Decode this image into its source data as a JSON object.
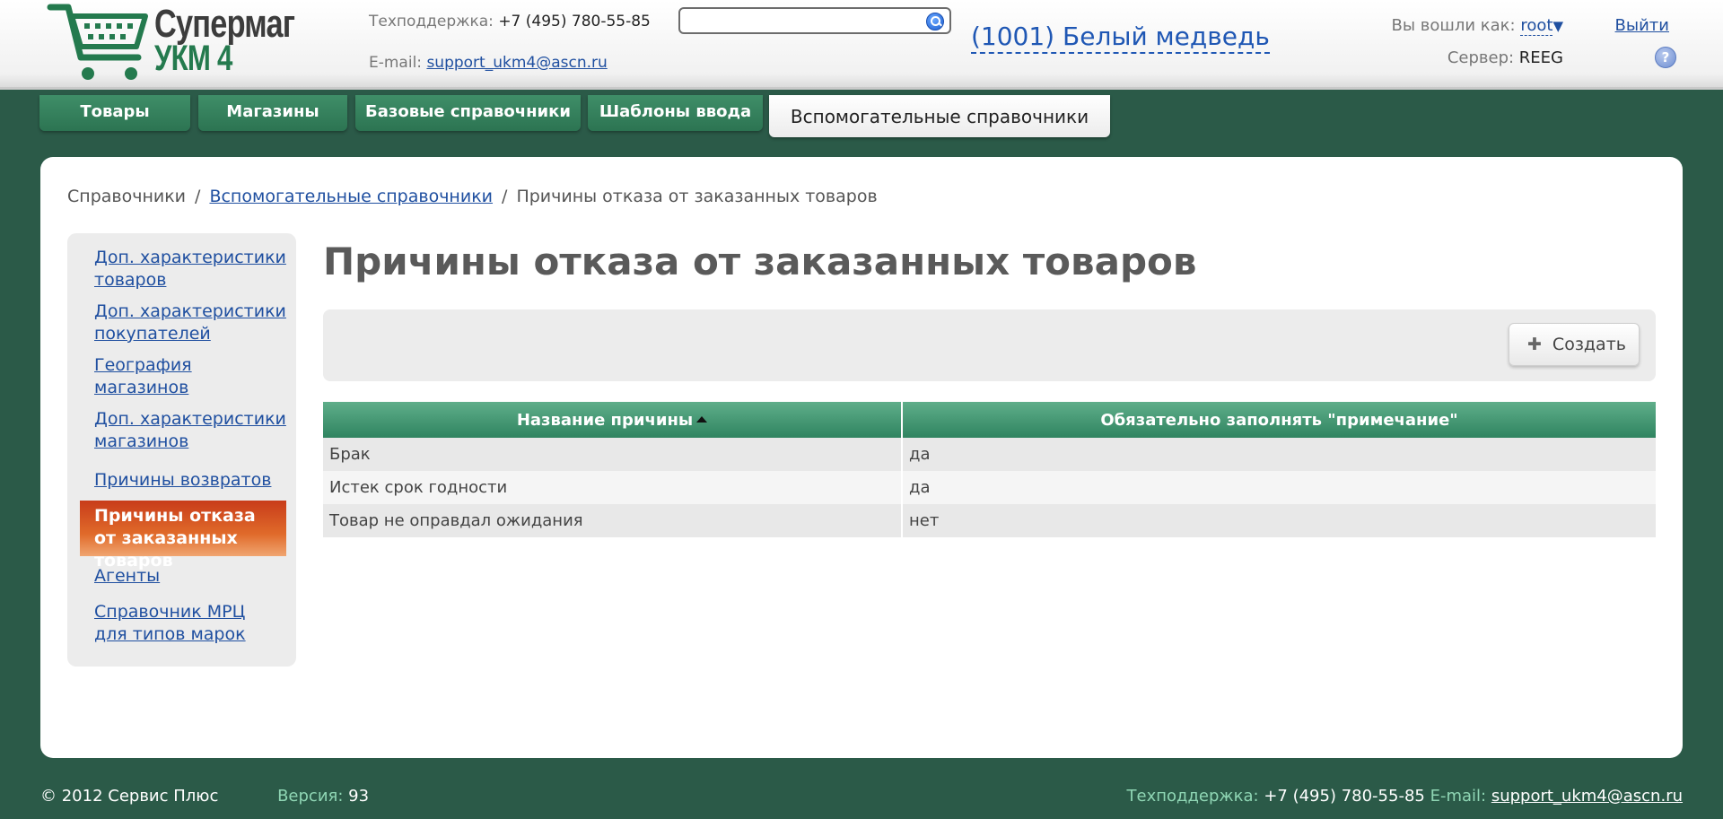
{
  "logo": {
    "line1": "Супермаг",
    "line2": "УКМ 4",
    "icon": "shopping-cart-icon"
  },
  "header": {
    "support_label": "Техподдержка:",
    "support_phone": "+7 (495) 780-55-85",
    "email_label": "E-mail:",
    "email": "support_ukm4@ascn.ru",
    "search": {
      "value": "",
      "placeholder": ""
    },
    "store_name": "(1001) Белый медведь",
    "logged_in_label": "Вы вошли как:",
    "user": "root",
    "user_dropdown_glyph": "▼",
    "logout": "Выйти",
    "server_label": "Сервер:",
    "server": "REEG",
    "help_glyph": "?"
  },
  "tabs": [
    {
      "label": "Товары"
    },
    {
      "label": "Магазины"
    },
    {
      "label": "Базовые справочники"
    },
    {
      "label": "Шаблоны ввода"
    },
    {
      "label": "Вспомогательные справочники",
      "active": true
    }
  ],
  "breadcrumb": {
    "root": "Справочники",
    "separator": "/",
    "section": "Вспомогательные справочники",
    "current": "Причины отказа от заказанных товаров"
  },
  "sidebar": {
    "items": [
      {
        "label": "Доп. характеристики товаров"
      },
      {
        "label": "Доп. характеристики покупателей"
      },
      {
        "label": "География магазинов"
      },
      {
        "label": "Доп. характеристики магазинов"
      },
      {
        "label": "Причины возвратов"
      },
      {
        "label": "Причины отказа от заказанных товаров",
        "active": true
      },
      {
        "label": "Агенты"
      },
      {
        "label": "Справочник МРЦ для типов марок"
      }
    ]
  },
  "main": {
    "title": "Причины отказа от заказанных товаров",
    "create_plus": "✚",
    "create_label": "Создать",
    "table": {
      "columns": [
        "Название причины",
        "Обязательно заполнять \"примечание\""
      ],
      "sort": {
        "column": 0,
        "direction": "asc"
      },
      "rows": [
        [
          "Брак",
          "да"
        ],
        [
          "Истек срок годности",
          "да"
        ],
        [
          "Товар не оправдал ожидания",
          "нет"
        ]
      ]
    }
  },
  "footer": {
    "copyright": "© 2012 Сервис Плюс",
    "version_label": "Версия:",
    "version": "93",
    "support_label": "Техподдержка:",
    "support_phone": "+7 (495) 780-55-85",
    "email_label": "E-mail:",
    "email": "support_ukm4@ascn.ru"
  },
  "colors": {
    "background": "#2b5a48",
    "tab": "#2c7452",
    "active_side": "#c83c1a",
    "link": "#1f4fa0",
    "table_header": "#3f9470"
  }
}
